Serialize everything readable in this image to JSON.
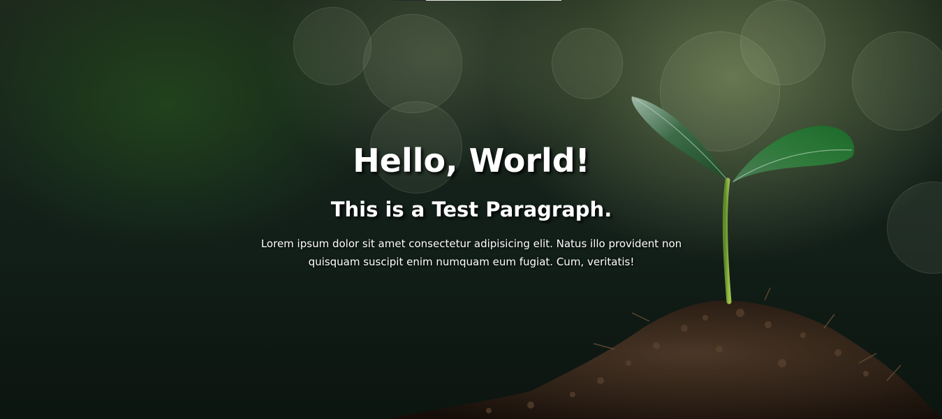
{
  "hero": {
    "title": "Hello, World!",
    "subtitle": "This is a Test Paragraph.",
    "paragraph": "Lorem ipsum dolor sit amet consectetur adipisicing elit. Natus illo provident non quisquam suscipit enim numquam eum fugiat. Cum, veritatis!",
    "background_image": "seedling-in-soil-photo",
    "colors": {
      "text": "#ffffff",
      "background_dark": "#13201a",
      "leaf": "#2f7a3a",
      "soil": "#3a2a1e"
    }
  }
}
